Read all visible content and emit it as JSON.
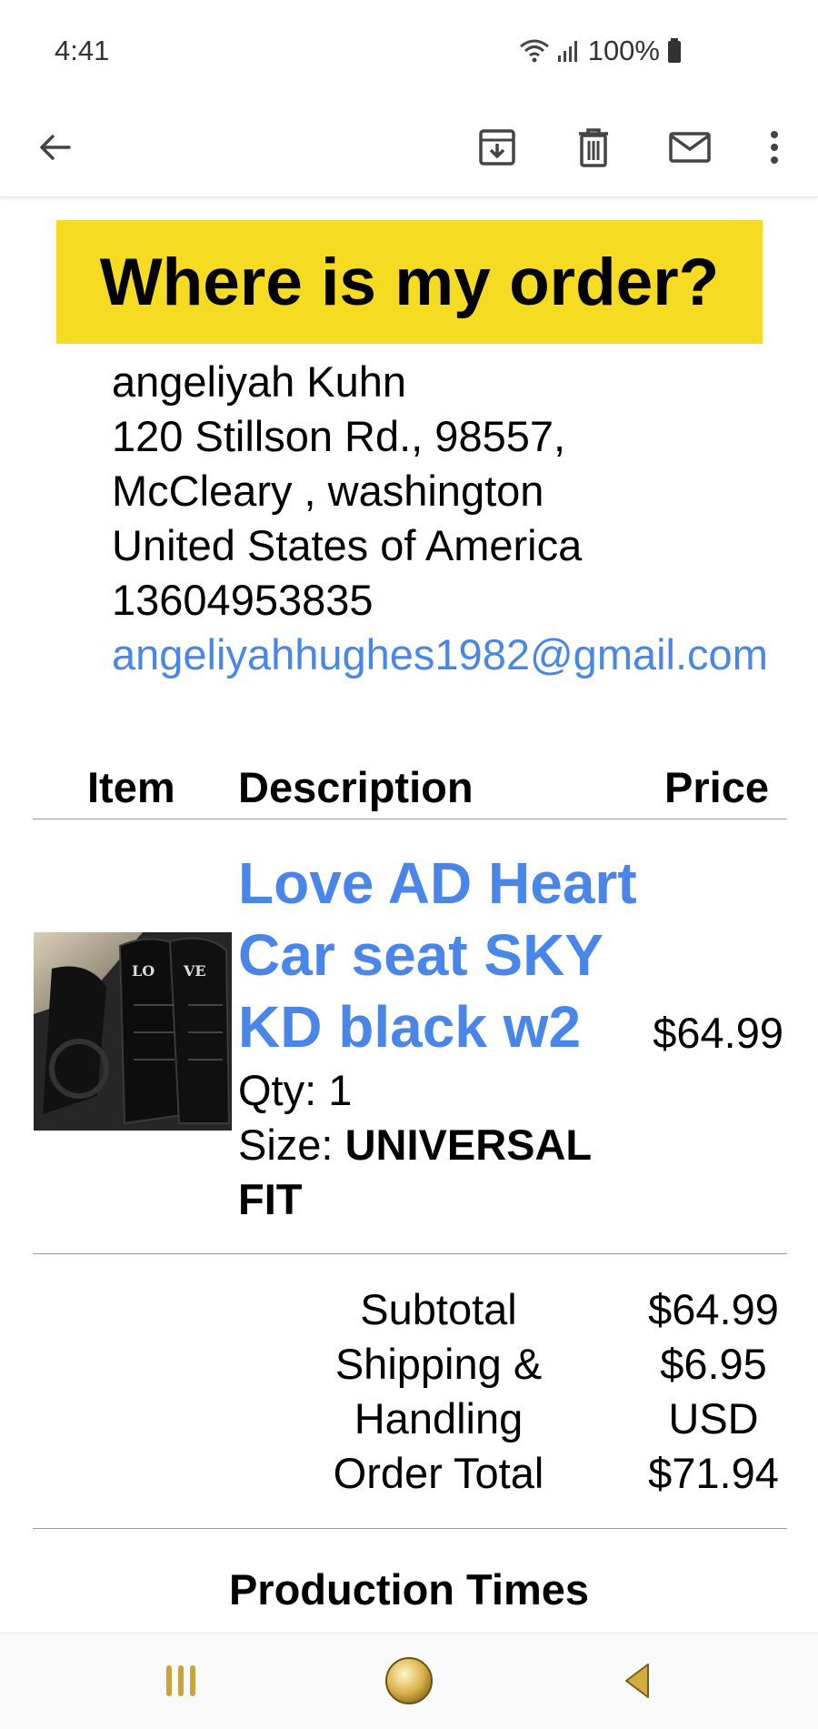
{
  "status_bar": {
    "time": "4:41",
    "battery": "100%",
    "icons": [
      "wifi-icon",
      "signal-icon",
      "battery-icon"
    ]
  },
  "toolbar": {
    "icons": [
      "back-arrow-icon",
      "archive-icon",
      "delete-icon",
      "mail-icon",
      "more-options-icon"
    ]
  },
  "email": {
    "banner": "Where is my order?",
    "address": {
      "name": "angeliyah Kuhn",
      "street": "120 Stillson Rd., 98557,",
      "city": "McCleary , washington",
      "country": "United States of America",
      "phone": "13604953835",
      "email": "angeliyahhughes1982@gmail.com"
    },
    "table": {
      "headers": {
        "item": "Item",
        "description": "Description",
        "price": "Price"
      },
      "row": {
        "title": "Love AD Heart Car seat SKY KD black w2",
        "qty_label": "Qty:",
        "qty": "1",
        "size_label": "Size:",
        "size": "UNIVERSAL FIT",
        "price": "$64.99"
      }
    },
    "totals": {
      "labels": [
        "Subtotal",
        "Shipping &",
        "Handling",
        "Order Total"
      ],
      "values": [
        "$64.99",
        "$6.95",
        "USD",
        "$71.94"
      ]
    },
    "section_title": "Production Times"
  },
  "nav": {
    "icons": [
      "recent-apps-icon",
      "home-icon",
      "back-icon"
    ]
  },
  "colors": {
    "banner": "#f5dc23",
    "link": "#4a86e8"
  }
}
